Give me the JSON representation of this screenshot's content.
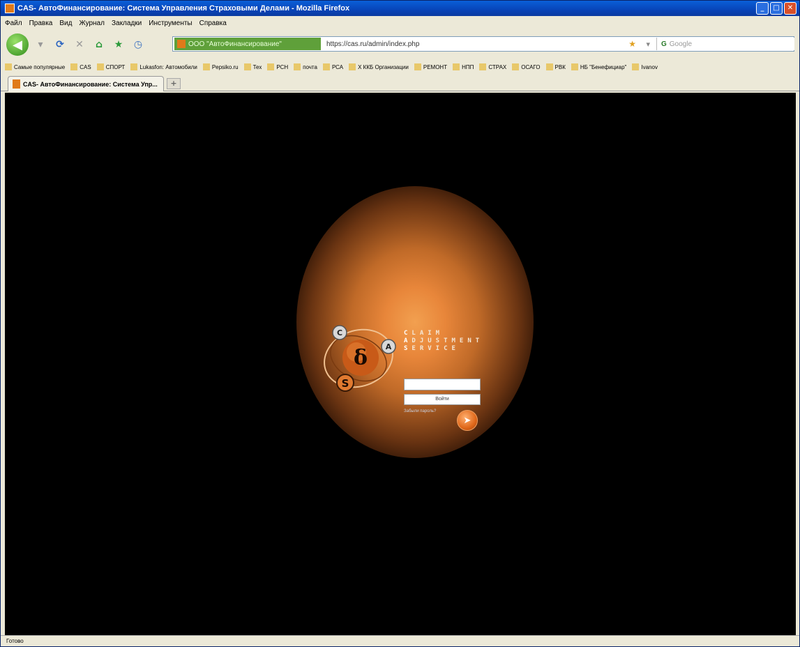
{
  "window": {
    "title": "CAS- АвтоФинансирование: Система Управления Страховыми Делами - Mozilla Firefox",
    "controls": {
      "minimize": "_",
      "maximize": "□",
      "close": "✕"
    }
  },
  "menu": [
    "Файл",
    "Правка",
    "Вид",
    "Журнал",
    "Закладки",
    "Инструменты",
    "Справка"
  ],
  "navigation": {
    "back_icon": "arrow-left-icon",
    "site_identity": "ООО \"АвтоФинансирование\"",
    "url": "https://cas.ru/admin/index.php",
    "search_placeholder": "Google",
    "search_engine": "G"
  },
  "bookmarks": [
    "Самые популярные",
    "CAS",
    "СПОРТ",
    "Lukasfon: Автомобили",
    "Pepsiko.ru",
    "Тех",
    "РСН",
    "почта",
    "РСА",
    "Х ККБ Организации",
    "РЕМОНТ",
    "НПП",
    "СТРАХ",
    "ОСАГО",
    "РВК",
    "НБ \"Бенефициар\"",
    "Ivanov"
  ],
  "tab": {
    "title": "CAS- АвтоФинансирование: Система Упр...",
    "new_tab": "+"
  },
  "brand": {
    "lines": [
      {
        "first": "C",
        "rest": "LAIM"
      },
      {
        "first": "A",
        "rest": "DJUSTMENT"
      },
      {
        "first": "S",
        "rest": "ERVICE"
      }
    ]
  },
  "login": {
    "input_value": "",
    "button_label": "Войти",
    "forgot_link": "Забыли пароль?",
    "go_icon": "go-arrow-icon"
  },
  "status": "Готово",
  "colors": {
    "accent": "#e8863a",
    "background": "#000000",
    "titlebar": "#0a5fd8"
  }
}
